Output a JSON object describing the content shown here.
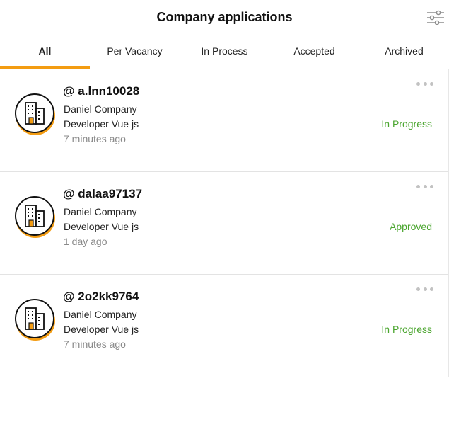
{
  "header": {
    "title": "Company applications",
    "filter_icon": "sliders-icon"
  },
  "tabs": [
    {
      "label": "All",
      "active": true
    },
    {
      "label": "Per Vacancy",
      "active": false
    },
    {
      "label": "In Process",
      "active": false
    },
    {
      "label": "Accepted",
      "active": false
    },
    {
      "label": "Archived",
      "active": false
    }
  ],
  "colors": {
    "accent": "#f39c12",
    "status_green": "#4aa52e",
    "muted_text": "#8a8a8a"
  },
  "applications": [
    {
      "username": "@ a.lnn10028",
      "company": "Daniel Company",
      "vacancy": "Developer Vue js",
      "time": "7 minutes ago",
      "status": "In Progress"
    },
    {
      "username": "@ dalaa97137",
      "company": "Daniel Company",
      "vacancy": "Developer Vue js",
      "time": "1 day ago",
      "status": "Approved"
    },
    {
      "username": "@ 2o2kk9764",
      "company": "Daniel Company",
      "vacancy": "Developer Vue js",
      "time": "7 minutes ago",
      "status": "In Progress"
    }
  ]
}
